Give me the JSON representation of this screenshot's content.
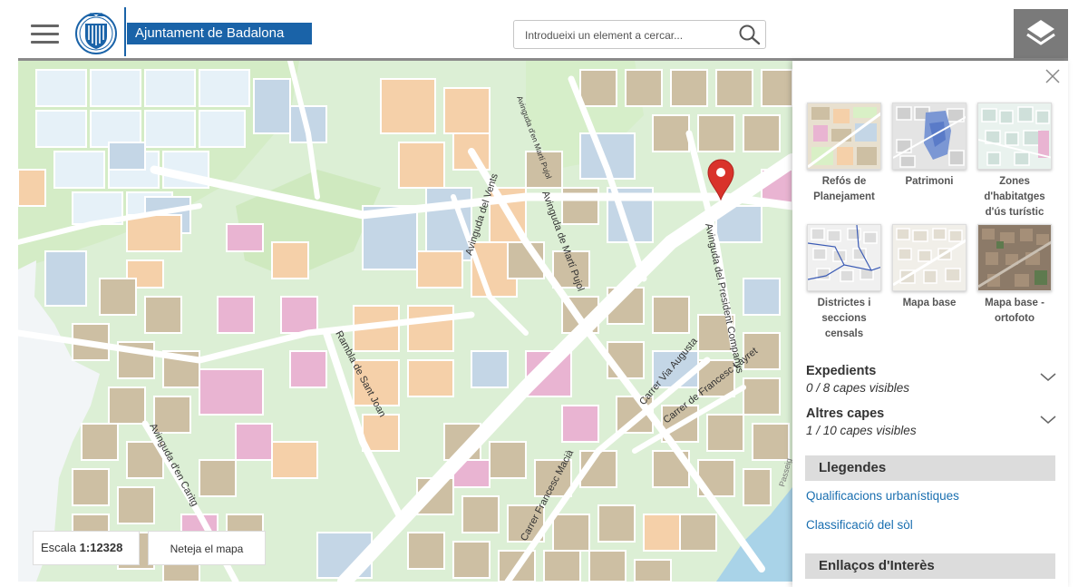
{
  "header": {
    "brand_name": "Ajuntament de Badalona",
    "search_placeholder": "Introdueixi un element a cercar..."
  },
  "map": {
    "street_labels": [
      "Avinguda del Vents",
      "Avinguda de Martí Pujol",
      "Avinguda d'en Martí Pujol",
      "Avinguda del President Companys",
      "Rambla de Sant Joan",
      "Avinguda d'en Caritg",
      "Carrer Via Augusta",
      "Carrer de Francesc Layret",
      "Carrer Francesc Macià",
      "Passeig"
    ],
    "scale_label": "Escala",
    "scale_value": "1:12328",
    "clear_button": "Neteja el mapa"
  },
  "colors": {
    "brand_blue": "#1a63a8",
    "header_rule": "#8a8a8a",
    "layers_button": "#7a7a7a",
    "marker_red": "#d9332b",
    "link_blue": "#1a6fb0",
    "block_tan": "#cdbfa3",
    "block_orange": "#f5d0a9",
    "block_pink": "#e9b4d2",
    "block_blue": "#c4d6e6",
    "park_green": "#d9f0c6"
  },
  "panel": {
    "basemaps": [
      {
        "label": "Refós de Planejament",
        "icon": "thumb-planning"
      },
      {
        "label": "Patrimoni",
        "icon": "thumb-heritage"
      },
      {
        "label": "Zones d'habitatges d'ús turístic",
        "icon": "thumb-tourist"
      },
      {
        "label": "Districtes i seccions censals",
        "icon": "thumb-districts"
      },
      {
        "label": "Mapa base",
        "icon": "thumb-base"
      },
      {
        "label": "Mapa base - ortofoto",
        "icon": "thumb-ortho"
      }
    ],
    "expedients": {
      "title": "Expedients",
      "subtitle": "0 / 8 capes visibles"
    },
    "altres": {
      "title": "Altres capes",
      "subtitle": "1 / 10 capes visibles"
    },
    "llegendes": {
      "title": "Llegendes",
      "links": [
        "Qualificacions urbanístiques",
        "Classificació del sòl"
      ]
    },
    "enllacos": {
      "title": "Enllaços d'Interès"
    }
  },
  "icons": [
    "menu-icon",
    "search-icon",
    "layers-icon",
    "close-icon",
    "chevron-down-icon",
    "map-marker-icon"
  ]
}
